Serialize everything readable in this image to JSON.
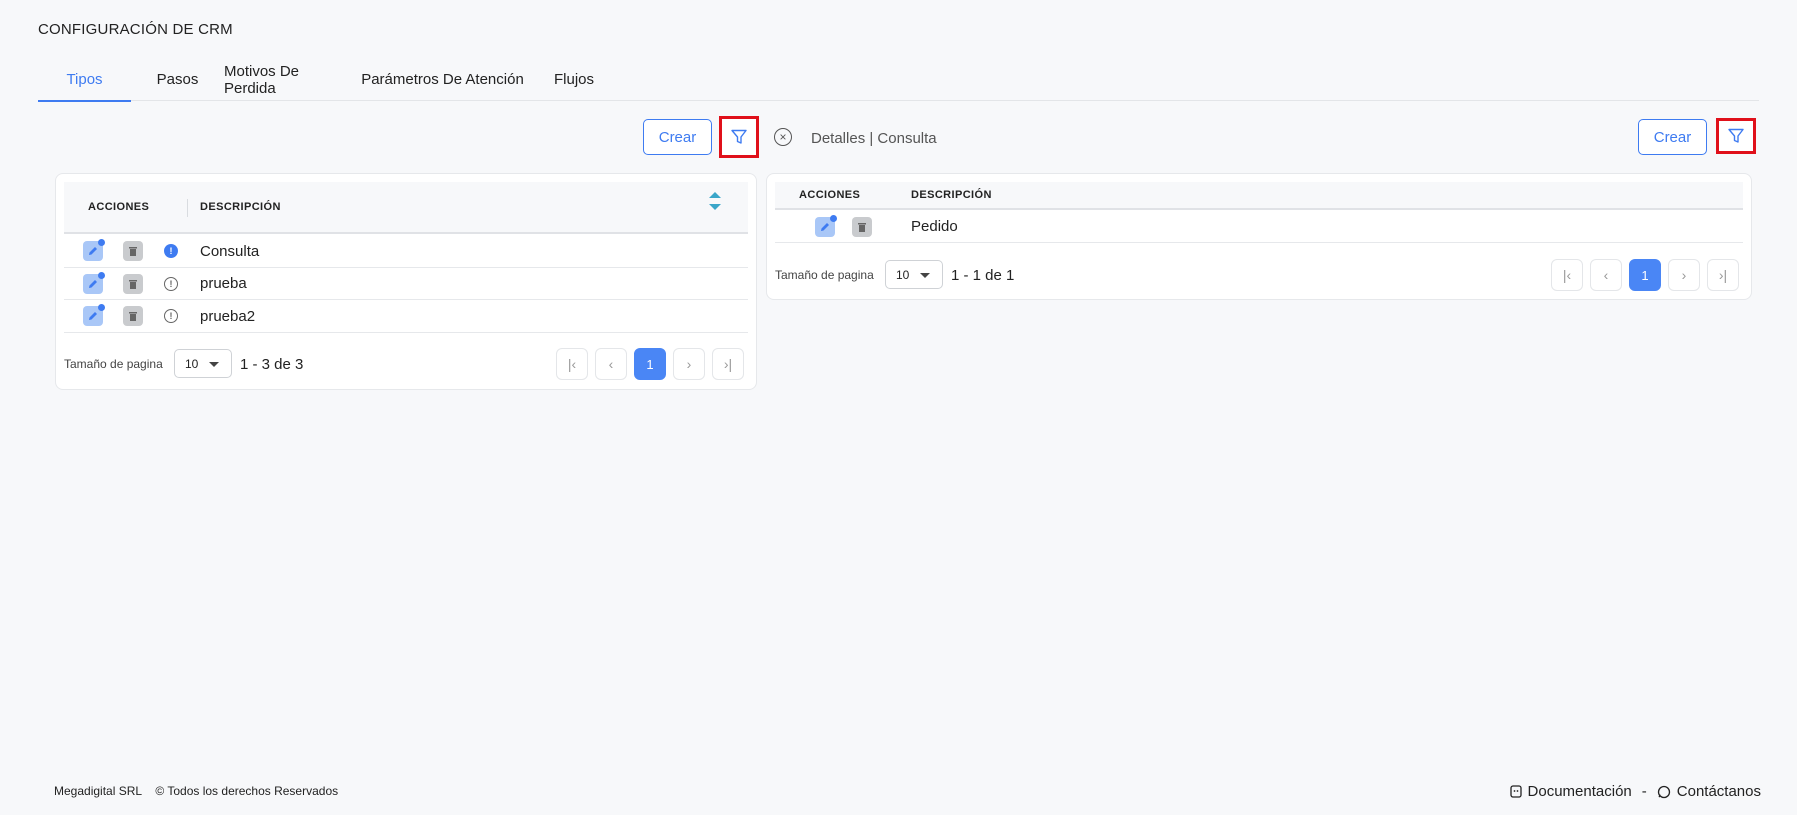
{
  "page": {
    "title": "CONFIGURACIÓN DE CRM"
  },
  "tabs": [
    {
      "label": "Tipos",
      "active": true
    },
    {
      "label": "Pasos",
      "active": false
    },
    {
      "label": "Motivos De Perdida",
      "active": false
    },
    {
      "label": "Parámetros De Atención",
      "active": false
    },
    {
      "label": "Flujos",
      "active": false
    }
  ],
  "left_panel": {
    "create_label": "Crear",
    "filter_icon": "filter-icon",
    "columns": {
      "actions": "ACCIONES",
      "description": "DESCRIPCIÓN"
    },
    "rows": [
      {
        "description": "Consulta",
        "selected": true
      },
      {
        "description": "prueba",
        "selected": false
      },
      {
        "description": "prueba2",
        "selected": false
      }
    ],
    "pagination": {
      "size_label": "Tamaño de pagina",
      "page_size": "10",
      "range": "1 - 3 de 3",
      "current_page": "1"
    }
  },
  "right_panel": {
    "details_title": "Detalles | Consulta",
    "create_label": "Crear",
    "filter_icon": "filter-icon",
    "columns": {
      "actions": "ACCIONES",
      "description": "DESCRIPCIÓN"
    },
    "rows": [
      {
        "description": "Pedido"
      }
    ],
    "pagination": {
      "size_label": "Tamaño de pagina",
      "page_size": "10",
      "range": "1 - 1 de 1",
      "current_page": "1"
    }
  },
  "footer": {
    "company": "Megadigital SRL",
    "rights": "© Todos los derechos Reservados",
    "docs_label": "Documentación",
    "separator": "-",
    "contact_label": "Contáctanos"
  },
  "colors": {
    "accent": "#3e7bf1",
    "highlight_border": "#e0101a",
    "sort_arrow": "#3aa6c9"
  }
}
